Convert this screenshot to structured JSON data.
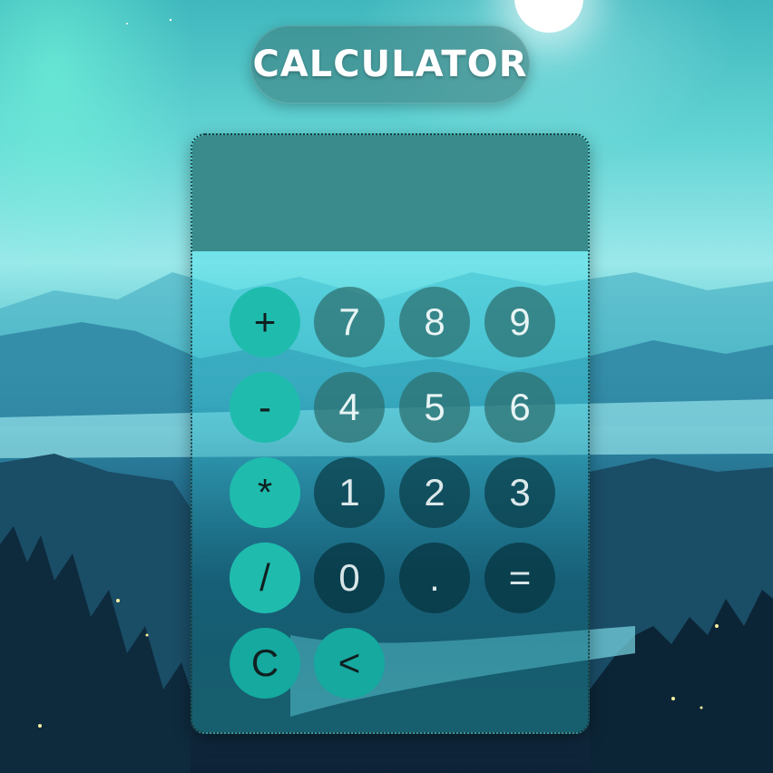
{
  "app": {
    "title": "Calculator"
  },
  "display": {
    "value": ""
  },
  "buttons": {
    "plus": "+",
    "seven": "7",
    "eight": "8",
    "nine": "9",
    "minus": "-",
    "four": "4",
    "five": "5",
    "six": "6",
    "multiply": "*",
    "one": "1",
    "two": "2",
    "three": "3",
    "divide": "/",
    "zero": "0",
    "dot": ".",
    "equals": "=",
    "clear": "C",
    "backspace": "<"
  },
  "colors": {
    "operator": "#1fbcae",
    "display_bg": "#3a8c8c",
    "number_bg": "#2d6e6e"
  }
}
